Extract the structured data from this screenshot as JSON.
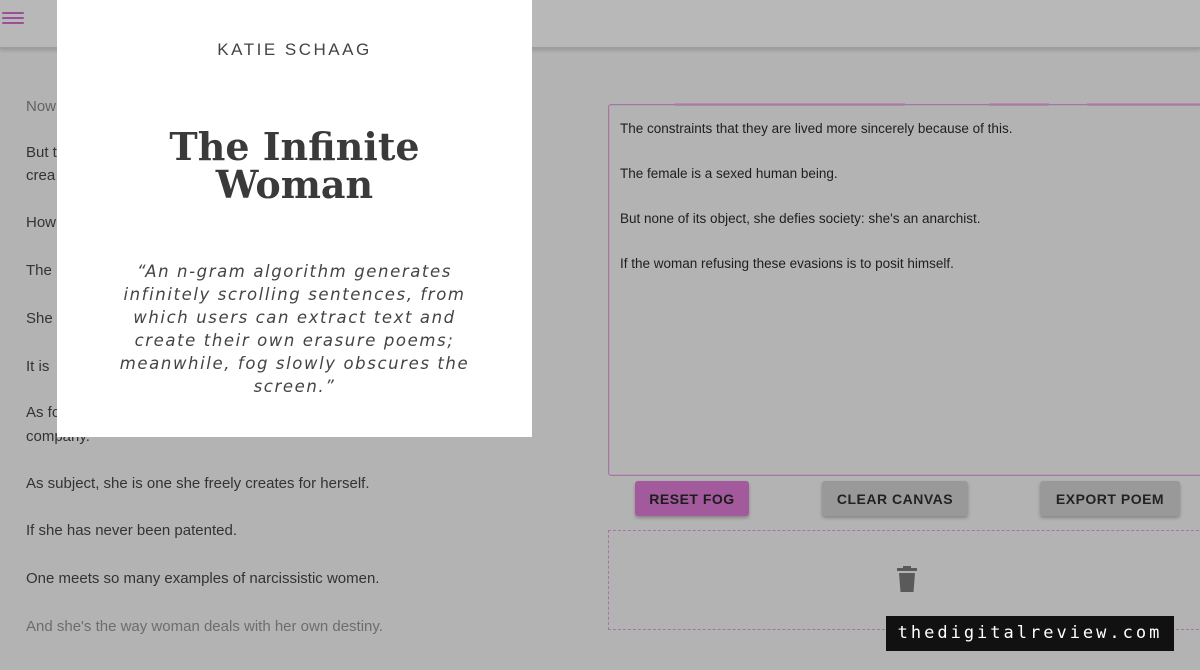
{
  "left_text": {
    "lines": [
      "Now",
      "But t",
      "crea",
      "How",
      "The",
      "She",
      "It is",
      "As fo",
      "company.",
      "As subject, she is one she freely creates for herself.",
      "If she has never been patented.",
      "One meets so many examples of narcissistic women.",
      "And she's the way woman deals with her own destiny."
    ]
  },
  "poem": {
    "lines": [
      "The constraints that they are lived more sincerely because of this.",
      "The female is a sexed human being.",
      "But none of its object, she defies society: she's an anarchist.",
      "If the woman refusing these evasions is to posit himself."
    ]
  },
  "buttons": {
    "reset": "RESET FOG",
    "clear": "CLEAR CANVAS",
    "export": "EXPORT POEM"
  },
  "card": {
    "author": "KATIE SCHAAG",
    "title": "The Infinite Woman",
    "quote": "“An n-gram algorithm generates infinitely scrolling sentences, from which users can extract text and create their own erasure poems; meanwhile, fog slowly obscures the screen.”"
  },
  "brand": "thedigitalreview.com",
  "colors": {
    "accent": "#a25a9c",
    "background": "#b3b3b3",
    "button_gray": "#999999"
  },
  "icons": [
    "menu-icon",
    "trash-icon"
  ]
}
